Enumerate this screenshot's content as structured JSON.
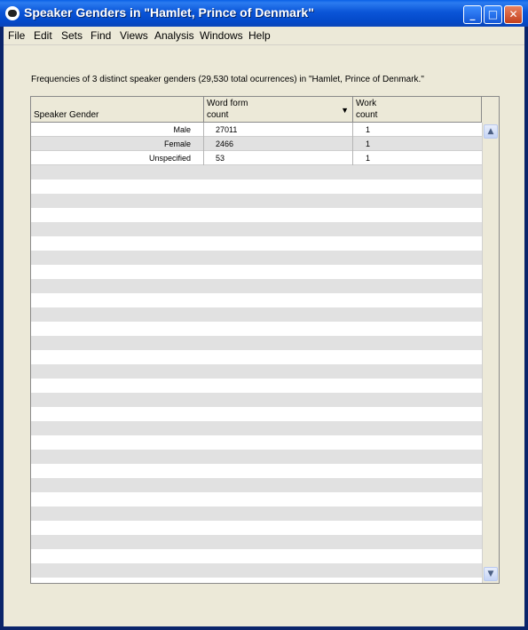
{
  "window": {
    "title": "Speaker Genders in \"Hamlet, Prince of Denmark\"",
    "minimize_glyph": "_",
    "maximize_glyph": "□",
    "close_glyph": "✕"
  },
  "menubar": [
    "File",
    "Edit",
    "Sets",
    "Find",
    "Views",
    "Analysis",
    "Windows",
    "Help"
  ],
  "caption": "Frequencies of 3 distinct speaker genders (29,530 total ocurrences) in \"Hamlet, Prince of Denmark.\"",
  "table": {
    "headers": [
      {
        "line1": "",
        "line2": "Speaker Gender"
      },
      {
        "line1": "Word form",
        "line2": "count",
        "sort": "▼"
      },
      {
        "line1": "Work",
        "line2": "count"
      }
    ],
    "rows": [
      {
        "gender": "Male",
        "word_form_count": "27011",
        "work_count": "1"
      },
      {
        "gender": "Female",
        "word_form_count": "2466",
        "work_count": "1"
      },
      {
        "gender": "Unspecified",
        "word_form_count": "53",
        "work_count": "1"
      }
    ],
    "scroll_up_glyph": "▲",
    "scroll_down_glyph": "▼"
  }
}
